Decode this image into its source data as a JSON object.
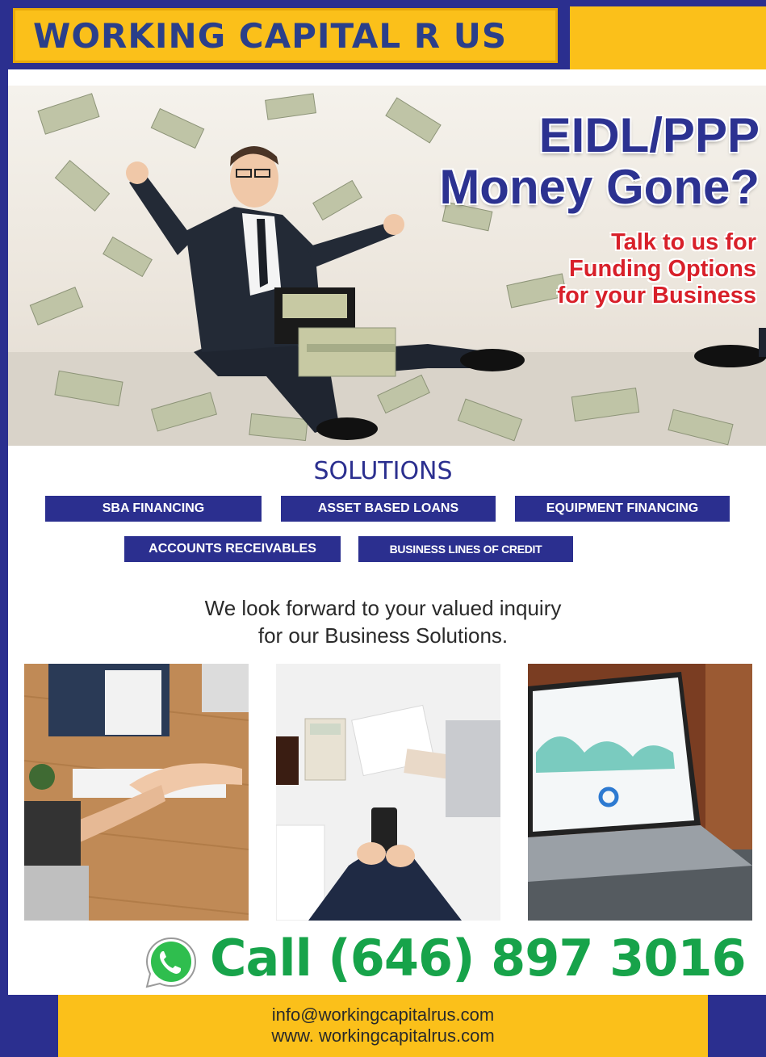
{
  "header": {
    "brand": "WORKING CAPITAL R US"
  },
  "hero": {
    "headline_line1": "EIDL/PPP",
    "headline_line2": "Money Gone?",
    "sub_line1": "Talk to us for",
    "sub_line2": "Funding Options",
    "sub_line3": "for your Business"
  },
  "solutions": {
    "title": "SOLUTIONS",
    "items": [
      "SBA FINANCING",
      "ASSET BASED LOANS",
      "EQUIPMENT FINANCING",
      "ACCOUNTS RECEIVABLES",
      "BUSINESS LINES OF CREDIT"
    ]
  },
  "inquiry": {
    "line1": "We look forward to your valued inquiry",
    "line2": "for our Business Solutions."
  },
  "contact": {
    "call": "Call (646) 897 3016",
    "email": "info@workingcapitalrus.com",
    "website": "www. workingcapitalrus.com"
  },
  "icons": [
    "whatsapp-icon"
  ],
  "colors": {
    "navy": "#2b2f8f",
    "gold": "#fbc01a",
    "red": "#d8202a",
    "green": "#17a34a"
  }
}
